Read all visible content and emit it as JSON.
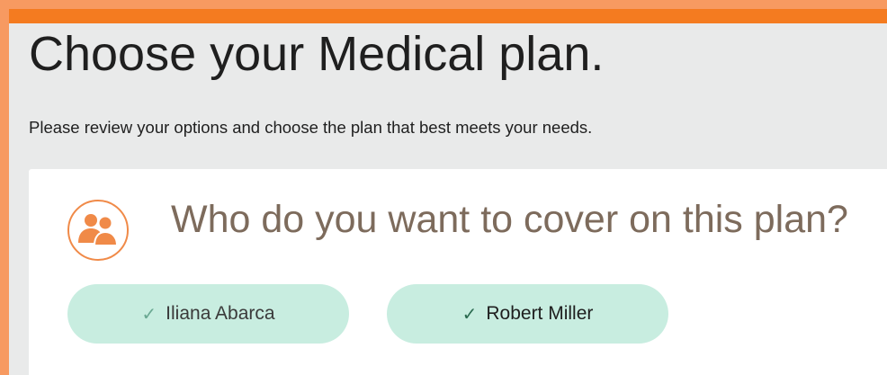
{
  "page": {
    "title": "Choose your Medical plan.",
    "subtitle": "Please review your options and choose the plan that best meets your needs."
  },
  "coverage": {
    "icon": "people-icon",
    "heading": "Who do you want to cover on this plan?",
    "members": [
      {
        "name": "Iliana Abarca",
        "selected": true,
        "check": "✓"
      },
      {
        "name": "Robert Miller",
        "selected": true,
        "check": "✓"
      }
    ]
  },
  "colors": {
    "frame": "#f79a61",
    "accent": "#f47b20",
    "pill": "#c8ede0",
    "heading": "#7d6b5c"
  }
}
